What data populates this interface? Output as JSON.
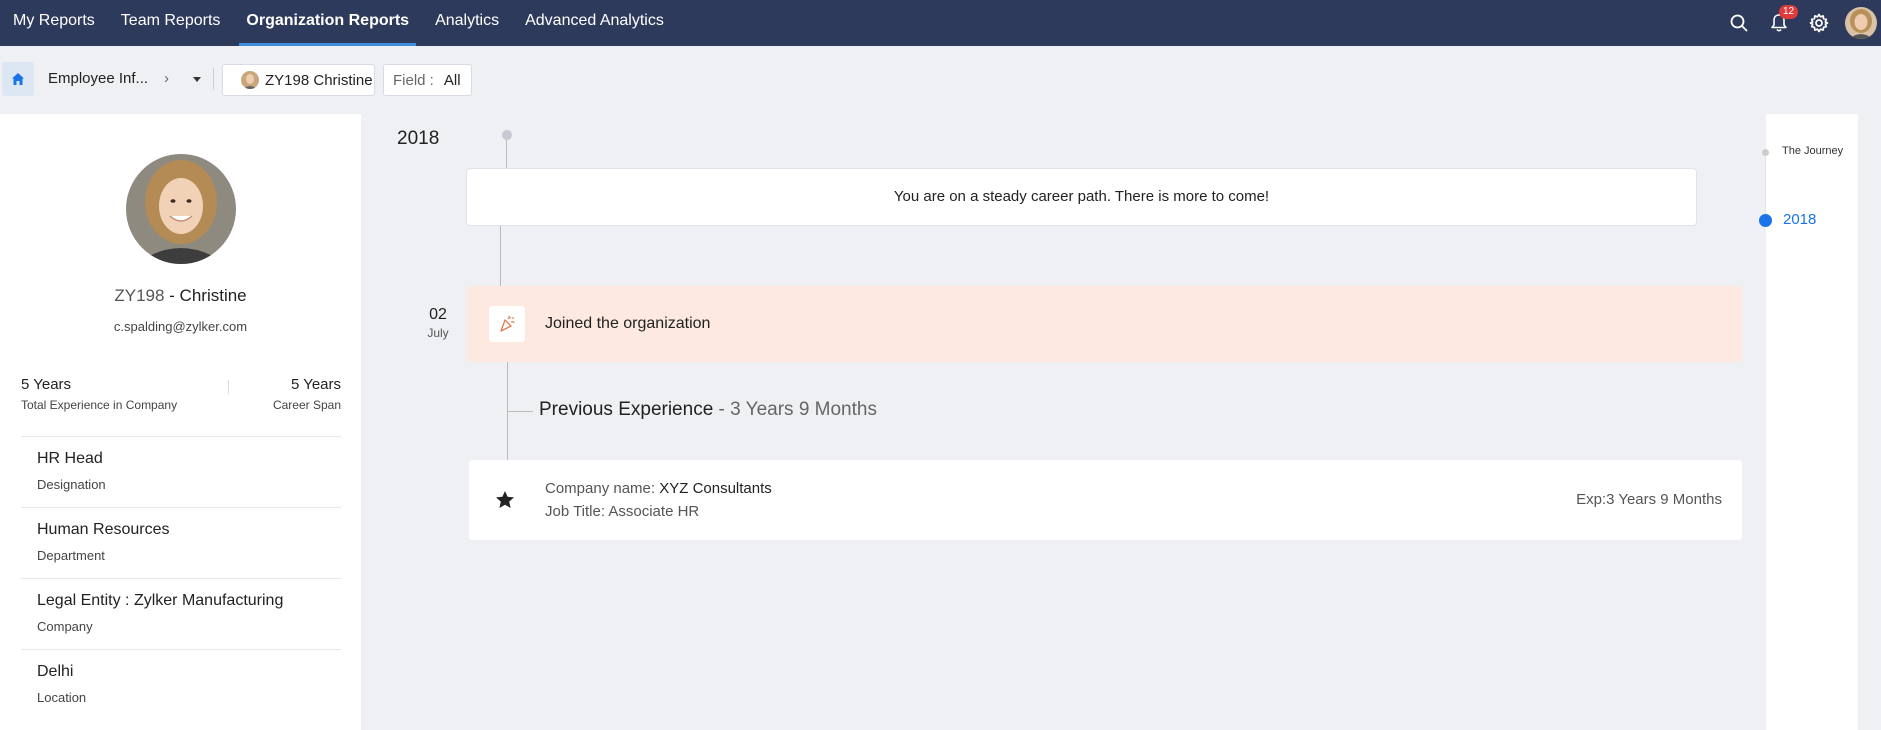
{
  "nav": {
    "tabs": [
      {
        "label": "My Reports"
      },
      {
        "label": "Team Reports"
      },
      {
        "label": "Organization Reports"
      },
      {
        "label": "Analytics"
      },
      {
        "label": "Advanced Analytics"
      }
    ],
    "active_tab": "Organization Reports",
    "notification_count": "12",
    "icons": [
      "search-icon",
      "bell-icon",
      "gear-icon",
      "user-avatar"
    ]
  },
  "breadcrumb": {
    "home_icon": "home-icon",
    "current": "Employee Inf...",
    "chevron": "›",
    "employee_chip": "ZY198 Christine",
    "field_label": "Field :",
    "field_value": "All"
  },
  "profile": {
    "id": "ZY198",
    "separator": " - ",
    "name": "Christine",
    "email": "c.spalding@zylker.com",
    "stats": [
      {
        "value": "5 Years",
        "label": "Total Experience in Company"
      },
      {
        "value": "5 Years",
        "label": "Career Span"
      }
    ],
    "details": [
      {
        "value": "HR Head",
        "label": "Designation"
      },
      {
        "value": "Human Resources",
        "label": "Department"
      },
      {
        "value": "Legal Entity : Zylker Manufacturing",
        "label": "Company"
      },
      {
        "value": "Delhi",
        "label": "Location"
      }
    ]
  },
  "timeline": {
    "year": "2018",
    "message": "You are on a steady career path. There is more to come!",
    "event": {
      "day": "02",
      "month": "July",
      "text": "Joined the organization",
      "icon": "party-popper-icon"
    },
    "previous_experience": {
      "heading": "Previous Experience",
      "duration": " - 3 Years 9 Months",
      "company_label": "Company name: ",
      "company": "XYZ Consultants",
      "job_title_label": "Job Title: ",
      "job_title": "Associate HR",
      "exp": "Exp:3 Years 9 Months",
      "icon": "star-icon"
    }
  },
  "journey": {
    "label": "The Journey",
    "years": [
      "2018"
    ]
  },
  "colors": {
    "nav_bg": "#2e3a5c",
    "accent": "#1a73e8",
    "event_bg": "#fde9e0",
    "badge": "#e03b3b"
  }
}
